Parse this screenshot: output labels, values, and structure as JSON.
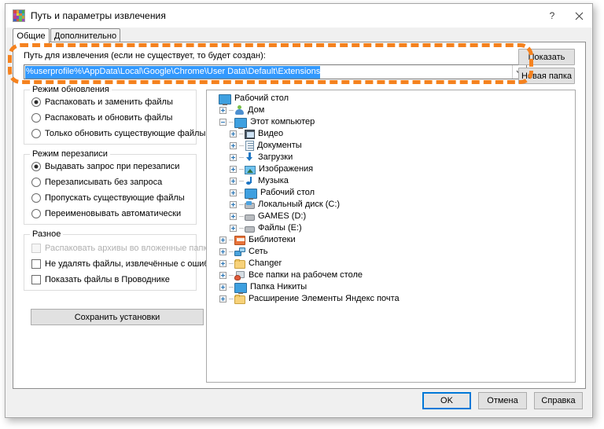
{
  "window": {
    "title": "Путь и параметры извлечения",
    "icon": "winrar-books-icon",
    "help_label": "?",
    "close_label": "✕"
  },
  "tabs": [
    {
      "label": "Общие",
      "active": true
    },
    {
      "label": "Дополнительно",
      "active": false
    }
  ],
  "path_section": {
    "label": "Путь для извлечения (если не существует, то будет создан):",
    "value": "%userprofile%\\AppData\\Local\\Google\\Chrome\\User Data\\Default\\Extensions",
    "selected": true,
    "dropdown_icon": "chevron-down-icon",
    "buttons": [
      {
        "label": "Показать"
      },
      {
        "label": "Новая папка"
      }
    ]
  },
  "groups": [
    {
      "title": "Режим обновления",
      "type": "radio",
      "options": [
        {
          "label": "Распаковать и заменить файлы",
          "checked": true
        },
        {
          "label": "Распаковать и обновить файлы",
          "checked": false
        },
        {
          "label": "Только обновить существующие файлы",
          "checked": false
        }
      ]
    },
    {
      "title": "Режим перезаписи",
      "type": "radio",
      "options": [
        {
          "label": "Выдавать запрос при перезаписи",
          "checked": true
        },
        {
          "label": "Перезаписывать без запроса",
          "checked": false
        },
        {
          "label": "Пропускать существующие файлы",
          "checked": false
        },
        {
          "label": "Переименовывать автоматически",
          "checked": false
        }
      ]
    },
    {
      "title": "Разное",
      "type": "checkbox",
      "options": [
        {
          "label": "Распаковать архивы во вложенные папки",
          "checked": false,
          "disabled": true
        },
        {
          "label": "Не удалять файлы, извлечённые с ошибками",
          "checked": false,
          "disabled": false
        },
        {
          "label": "Показать файлы в Проводнике",
          "checked": false,
          "disabled": false
        }
      ]
    }
  ],
  "save_button": {
    "label": "Сохранить установки"
  },
  "tree": {
    "items": [
      {
        "label": "Рабочий стол",
        "indent": 0,
        "expander": "none",
        "icon": "monitor-icon"
      },
      {
        "label": "Дом",
        "indent": 1,
        "expander": "plus",
        "icon": "user-icon"
      },
      {
        "label": "Этот компьютер",
        "indent": 1,
        "expander": "minus",
        "icon": "monitor-icon"
      },
      {
        "label": "Видео",
        "indent": 2,
        "expander": "plus",
        "icon": "video-icon"
      },
      {
        "label": "Документы",
        "indent": 2,
        "expander": "plus",
        "icon": "document-icon"
      },
      {
        "label": "Загрузки",
        "indent": 2,
        "expander": "plus",
        "icon": "download-icon"
      },
      {
        "label": "Изображения",
        "indent": 2,
        "expander": "plus",
        "icon": "picture-icon"
      },
      {
        "label": "Музыка",
        "indent": 2,
        "expander": "plus",
        "icon": "music-icon"
      },
      {
        "label": "Рабочий стол",
        "indent": 2,
        "expander": "plus",
        "icon": "monitor-icon"
      },
      {
        "label": "Локальный диск (C:)",
        "indent": 2,
        "expander": "plus",
        "icon": "system-disk-icon"
      },
      {
        "label": "GAMES (D:)",
        "indent": 2,
        "expander": "plus",
        "icon": "disk-icon"
      },
      {
        "label": "Файлы (E:)",
        "indent": 2,
        "expander": "plus",
        "icon": "disk-icon"
      },
      {
        "label": "Библиотеки",
        "indent": 1,
        "expander": "plus",
        "icon": "library-icon"
      },
      {
        "label": "Сеть",
        "indent": 1,
        "expander": "plus",
        "icon": "network-icon"
      },
      {
        "label": "Changer",
        "indent": 1,
        "expander": "plus",
        "icon": "folder-icon"
      },
      {
        "label": "Все папки на рабочем столе",
        "indent": 1,
        "expander": "plus",
        "icon": "desktop-icon"
      },
      {
        "label": "Папка Никиты",
        "indent": 1,
        "expander": "plus",
        "icon": "monitor-icon"
      },
      {
        "label": "Расширение  Элементы Яндекс почта",
        "indent": 1,
        "expander": "plus",
        "icon": "folder-icon"
      }
    ]
  },
  "dialog_buttons": [
    {
      "label": "OK",
      "primary": true
    },
    {
      "label": "Отмена",
      "primary": false
    },
    {
      "label": "Справка",
      "primary": false
    }
  ],
  "annotation": {
    "shape": "dashed-rounded-rectangle",
    "color": "#f5821f"
  },
  "icon_palette": [
    "#d64545",
    "#e0a03a",
    "#3f7fc1",
    "#4aa84a",
    "#b04fb0",
    "#d8d83a",
    "#e07a3a",
    "#3fb0b0",
    "#c43f7f",
    "#7f4fc4",
    "#4fc47f",
    "#c4a03f",
    "#3f5fc4",
    "#c45f3f",
    "#5fc43f",
    "#a03fc4"
  ]
}
